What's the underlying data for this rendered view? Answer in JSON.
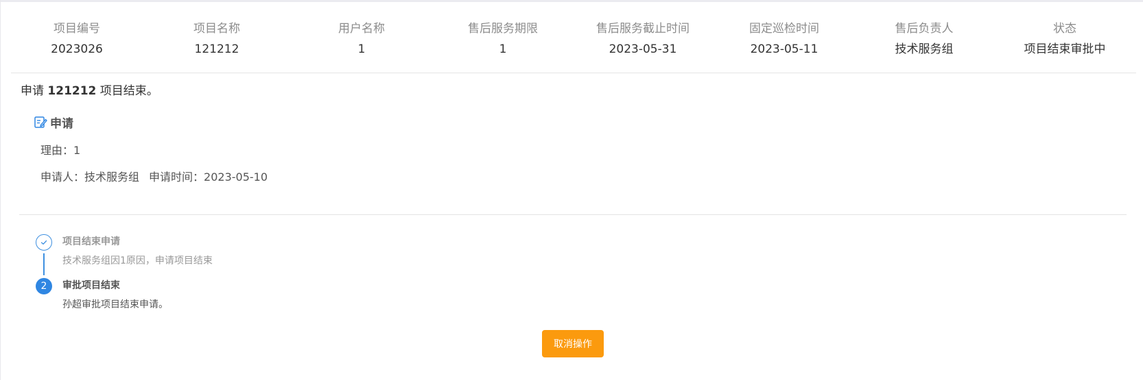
{
  "info": {
    "columns": [
      {
        "label": "项目编号",
        "value": "2023026"
      },
      {
        "label": "项目名称",
        "value": "121212"
      },
      {
        "label": "用户名称",
        "value": "1"
      },
      {
        "label": "售后服务期限",
        "value": "1"
      },
      {
        "label": "售后服务截止时间",
        "value": "2023-05-31"
      },
      {
        "label": "固定巡检时间",
        "value": "2023-05-11"
      },
      {
        "label": "售后负责人",
        "value": "技术服务组"
      },
      {
        "label": "状态",
        "value": "项目结束审批中"
      }
    ]
  },
  "summary": {
    "prefix": "申请 ",
    "project": "121212",
    "suffix": " 项目结束。"
  },
  "apply": {
    "title": "申请",
    "icon": "edit-icon",
    "reason_label": "理由：",
    "reason_value": "1",
    "applicant_label": "申请人：",
    "applicant_value": "技术服务组",
    "time_label": "申请时间：",
    "time_value": "2023-05-10"
  },
  "steps": [
    {
      "status": "done",
      "icon": "check-icon",
      "title": "项目结束申请",
      "desc": "技术服务组因1原因，申请项目结束"
    },
    {
      "status": "active",
      "number": "2",
      "title": "审批项目结束",
      "desc": "孙超审批项目结束申请。"
    }
  ],
  "actions": {
    "cancel_label": "取消操作"
  },
  "colors": {
    "accent": "#2f86e2",
    "cancel_button": "#fb9a0e"
  }
}
